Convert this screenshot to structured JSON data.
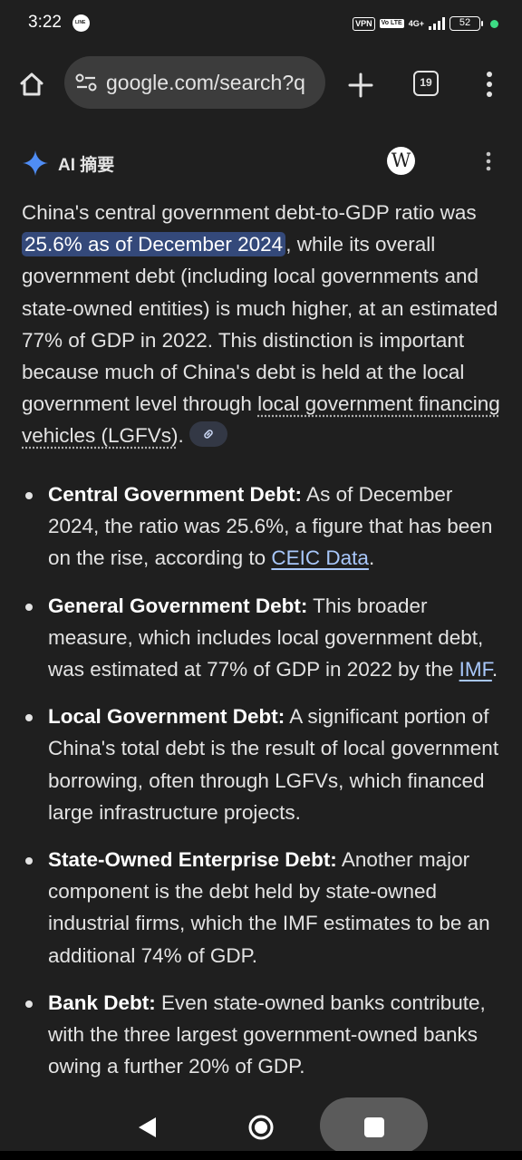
{
  "status_bar": {
    "time": "3:22",
    "app_badge": "LINE",
    "vpn": "VPN",
    "volte": "Vo LTE",
    "network": "4G+",
    "battery": "52"
  },
  "browser": {
    "url": "google.com/search?q",
    "tab_count": "19"
  },
  "ai_overview": {
    "title": "AI 摘要",
    "wiki_glyph": "W",
    "summary": {
      "part1": "China's central government debt-to-GDP ratio was ",
      "highlight": "25.6% as of December 2024",
      "part2": ", while its overall government debt (including local governments and state-owned entities) is much higher, at an estimated 77% of GDP in 2022. This distinction is important because much of China's debt is held at the local government level through ",
      "term": "local government financing vehicles (LGFVs)",
      "part3": "."
    },
    "bullets": [
      {
        "heading": "Central Government Debt:",
        "text": " As of December 2024, the ratio was 25.6%, a figure that has been on the rise, according to ",
        "link": "CEIC Data",
        "tail": "."
      },
      {
        "heading": "General Government Debt:",
        "text": " This broader measure, which includes local government debt, was estimated at 77% of GDP in 2022 by the ",
        "link": "IMF",
        "tail": "."
      },
      {
        "heading": "Local Government Debt:",
        "text": " A significant portion of China's total debt is the result of local government borrowing, often through LGFVs, which financed large infrastructure projects."
      },
      {
        "heading": "State-Owned Enterprise Debt:",
        "text": " Another major component is the debt held by state-owned industrial firms, which the IMF estimates to be an additional 74% of GDP."
      },
      {
        "heading": "Bank Debt:",
        "text": " Even state-owned banks contribute, with the three largest government-owned banks owing a further 20% of GDP."
      }
    ]
  },
  "colors": {
    "background": "#1f1f1f",
    "highlight": "#34497a",
    "link": "#a8c7fa",
    "sparkle": "#4f8df5"
  }
}
